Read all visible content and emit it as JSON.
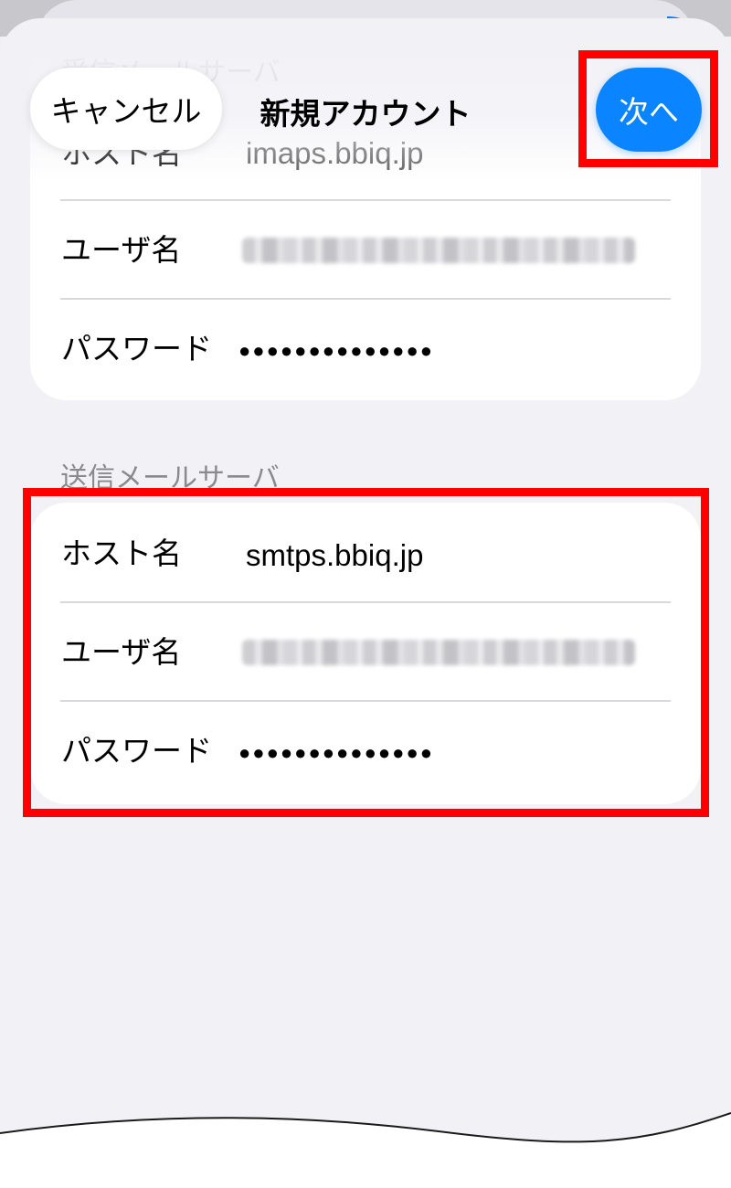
{
  "nav": {
    "cancel_label": "キャンセル",
    "title": "新規アカウント",
    "next_label": "次へ"
  },
  "incoming": {
    "header": "受信メールサーバ",
    "host_label": "ホスト名",
    "host_value": "imaps.bbiq.jp",
    "user_label": "ユーザ名",
    "user_value_icon": "blurred-text",
    "password_label": "パスワード",
    "password_value": "●●●●●●●●●●●●●●"
  },
  "outgoing": {
    "header": "送信メールサーバ",
    "host_label": "ホスト名",
    "host_value": "smtps.bbiq.jp",
    "user_label": "ユーザ名",
    "user_value_icon": "blurred-text",
    "password_label": "パスワード",
    "password_value": "●●●●●●●●●●●●●●"
  },
  "colors": {
    "accent": "#0a84ff",
    "highlight": "#ff0000",
    "background": "#f1f1f6",
    "section_header": "#8a8a8e"
  }
}
